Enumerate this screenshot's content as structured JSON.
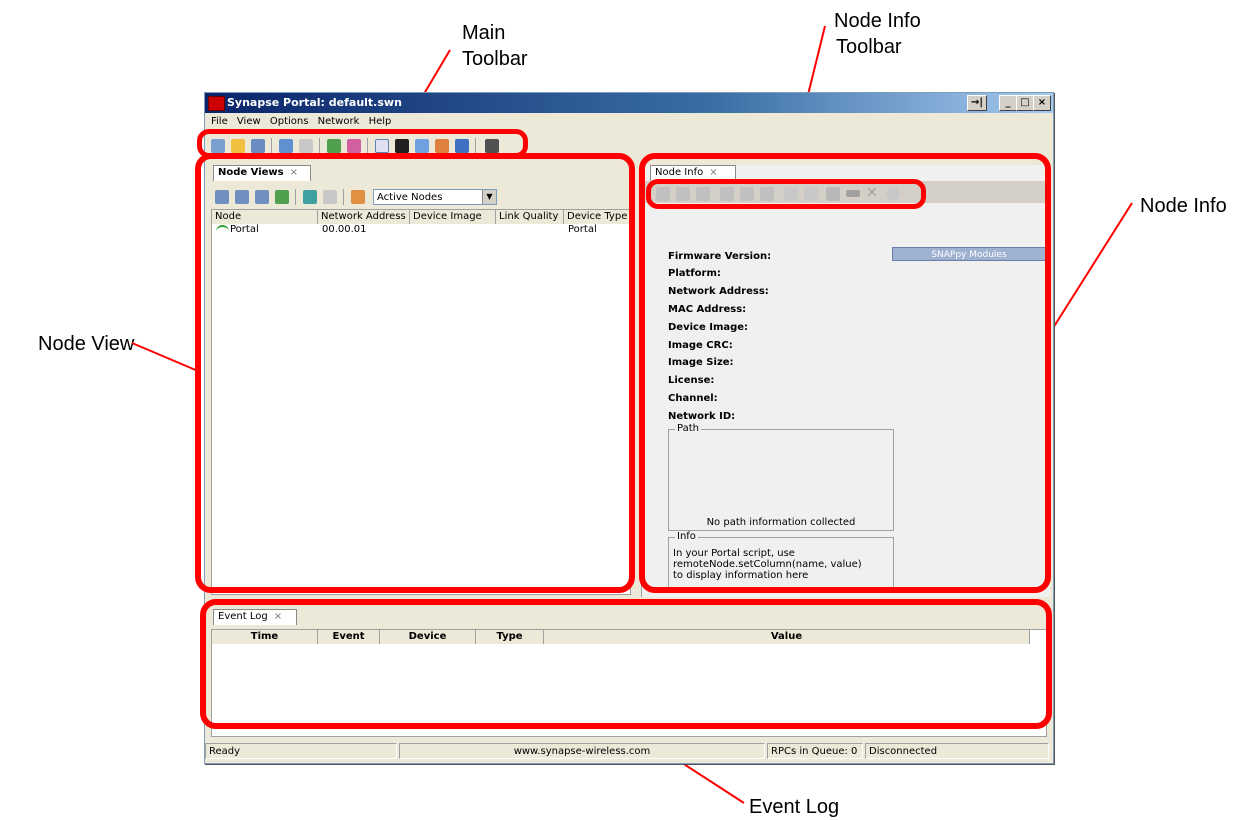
{
  "callouts": {
    "main_toolbar": [
      "Main",
      "Toolbar"
    ],
    "node_info_toolbar": [
      "Node Info",
      "Toolbar"
    ],
    "node_info": "Node Info",
    "node_view": "Node View",
    "event_log": "Event Log"
  },
  "window": {
    "title": "Synapse Portal: default.swn",
    "controls": {
      "pin": "→|",
      "minimize": "_",
      "maximize": "□",
      "close": "×"
    }
  },
  "menu": [
    "File",
    "View",
    "Options",
    "Network",
    "Help"
  ],
  "node_views": {
    "tab_label": "Node Views",
    "tab_close": "×",
    "filter_value": "Active Nodes",
    "columns": [
      "Node",
      "Network Address",
      "Device Image",
      "Link Quality",
      "Device Type"
    ],
    "rows": [
      {
        "node": "Portal",
        "network_address": "00.00.01",
        "device_image": "",
        "link_quality": "",
        "device_type": "Portal"
      }
    ]
  },
  "node_info": {
    "tab_label": "Node Info",
    "tab_close": "×",
    "snappy_modules_label": "SNAPpy Modules",
    "fields": [
      "Firmware Version:",
      "Platform:",
      "Network Address:",
      "MAC Address:",
      "Device Image:",
      "Image CRC:",
      "Image Size:",
      "License:",
      "Channel:",
      "Network ID:"
    ],
    "path_title": "Path",
    "path_message": "No path information collected",
    "info_title": "Info",
    "info_lines": [
      "In your Portal script, use",
      "remoteNode.setColumn(name, value)",
      "to display information here"
    ]
  },
  "event_log": {
    "tab_label": "Event Log",
    "tab_close": "×",
    "columns": [
      "Time",
      "Event",
      "Device",
      "Type",
      "Value"
    ]
  },
  "status_bar": {
    "state": "Ready",
    "url": "www.synapse-wireless.com",
    "rpcs": "RPCs in Queue: 0",
    "connection": "Disconnected"
  },
  "colors": {
    "highlight": "#ff0000",
    "title_start": "#0a246a",
    "title_end": "#a6caf0",
    "chrome": "#ece9d8"
  }
}
